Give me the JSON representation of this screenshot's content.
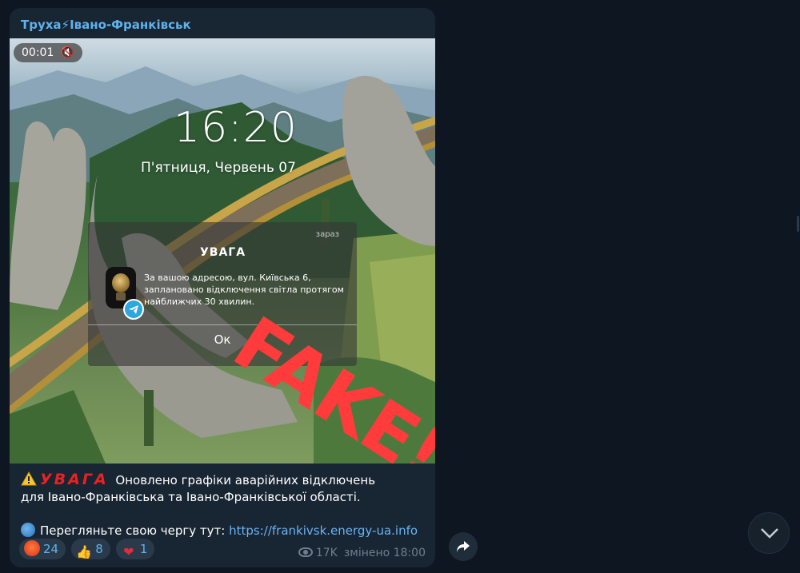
{
  "message": {
    "channel_name": "Труха⚡Івано-Франківськ",
    "video": {
      "timer": "00:01",
      "mute_icon": "speaker-muted-icon",
      "lockscreen": {
        "time": "16:20",
        "date": "П'ятниця, Червень 07"
      },
      "notification": {
        "when": "зараз",
        "title": "УВАГА",
        "body": "За вашою адресою, вул. Київська 6, заплановано відключення світла протягом найближчих 30 хвилин.",
        "button": "Ок"
      },
      "overlay_stamp": "FAKE!"
    },
    "caption": {
      "warning_emoji": "⚠️",
      "red_word": "УВАГА",
      "line1": " Оновлено графіки аварійних відключень",
      "line2": "для Івано-Франківська та Івано-Франківської області.",
      "globe_emoji": "🌐",
      "link_prefix": "Перегляньте свою чергу тут: ",
      "link_text": "https://frankivsk.energy-ua.info"
    },
    "reactions": [
      {
        "emoji": "😡",
        "count": "24"
      },
      {
        "emoji": "👍",
        "count": "8"
      },
      {
        "emoji": "❤",
        "count": "1"
      }
    ],
    "views": "17K",
    "edited_label": "змінено 18:00"
  },
  "colors": {
    "background": "#0e1621",
    "bubble": "#182533",
    "accent": "#5fb2ee",
    "link": "#6ab3f3",
    "fake_red": "#ff3b3b"
  }
}
